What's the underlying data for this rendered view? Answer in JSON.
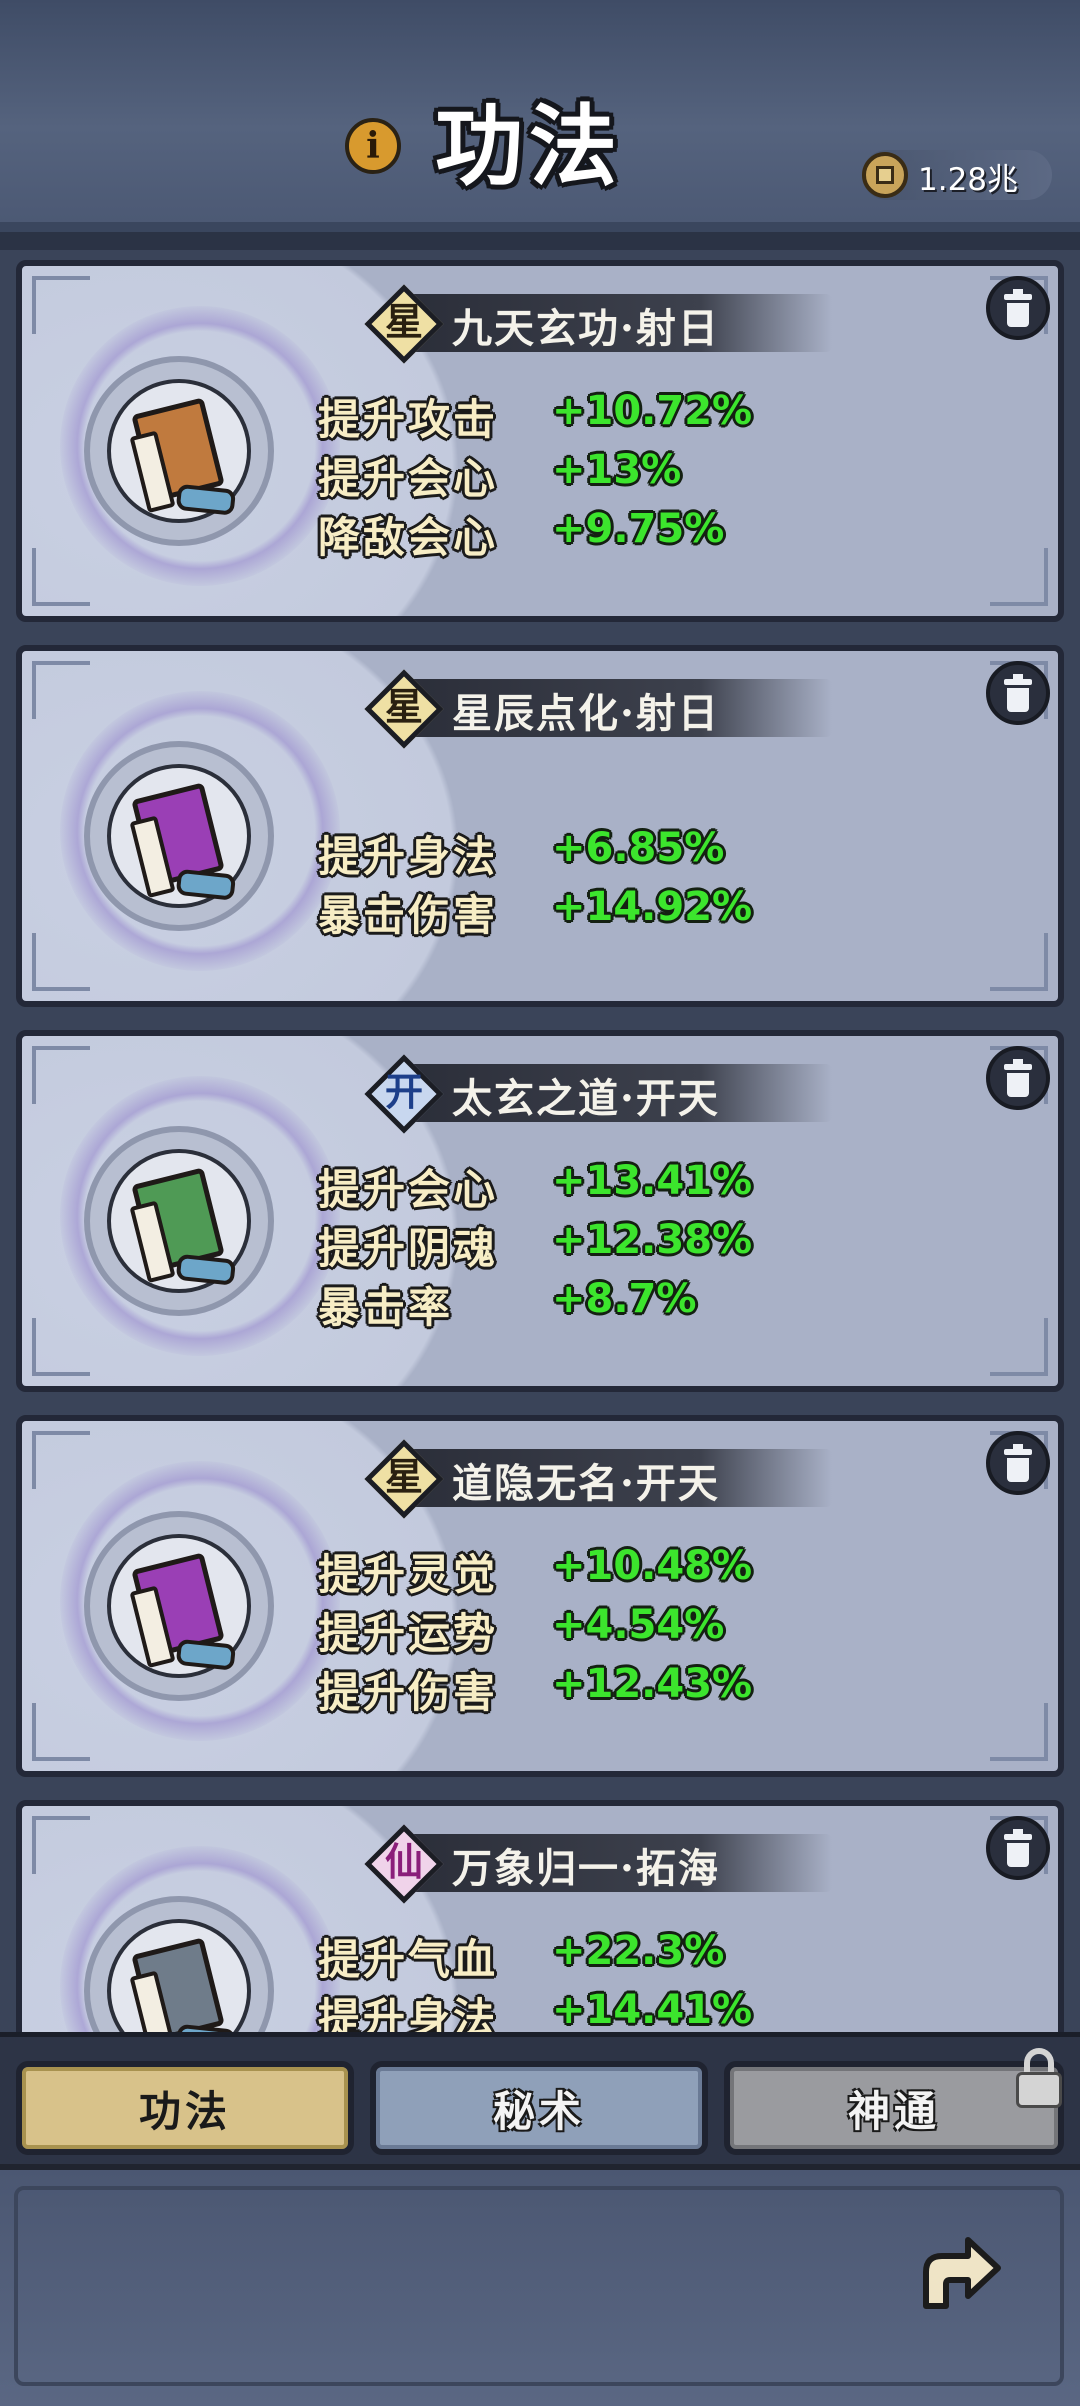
{
  "header": {
    "title": "功法",
    "info_icon": "info-icon",
    "currency": {
      "icon": "coin-icon",
      "value": "1.28兆"
    }
  },
  "skills": [
    {
      "grade": "星",
      "grade_color": "#efe0a4",
      "name": "九天玄功·射日",
      "book_color": "#c07a3e",
      "stats": [
        {
          "label": "提升攻击",
          "value": "+10.72%"
        },
        {
          "label": "提升会心",
          "value": "+13%"
        },
        {
          "label": "降敌会心",
          "value": "+9.75%"
        }
      ]
    },
    {
      "grade": "星",
      "grade_color": "#efe0a4",
      "name": "星辰点化·射日",
      "book_color": "#9a3fb5",
      "stats": [
        {
          "label": "提升身法",
          "value": "+6.85%"
        },
        {
          "label": "暴击伤害",
          "value": "+14.92%"
        }
      ]
    },
    {
      "grade": "开",
      "grade_color": "#c8d7ef",
      "name": "太玄之道·开天",
      "book_color": "#4f9a55",
      "stats": [
        {
          "label": "提升会心",
          "value": "+13.41%"
        },
        {
          "label": "提升阴魂",
          "value": "+12.38%"
        },
        {
          "label": "暴击率",
          "value": "+8.7%"
        }
      ]
    },
    {
      "grade": "星",
      "grade_color": "#efe0a4",
      "name": "道隐无名·开天",
      "book_color": "#9a3fb5",
      "stats": [
        {
          "label": "提升灵觉",
          "value": "+10.48%"
        },
        {
          "label": "提升运势",
          "value": "+4.54%"
        },
        {
          "label": "提升伤害",
          "value": "+12.43%"
        }
      ]
    },
    {
      "grade": "仙",
      "grade_color": "#f0d3ea",
      "name": "万象归一·拓海",
      "book_color": "#6f7c8a",
      "stats": [
        {
          "label": "提升气血",
          "value": "+22.3%"
        },
        {
          "label": "提升身法",
          "value": "+14.41%"
        }
      ]
    }
  ],
  "tabs": [
    {
      "label": "功法",
      "state": "active"
    },
    {
      "label": "秘术",
      "state": "normal"
    },
    {
      "label": "神通",
      "state": "locked"
    }
  ],
  "icons": {
    "delete": "trash-icon",
    "lock": "lock-icon",
    "back": "back-arrow-icon"
  }
}
